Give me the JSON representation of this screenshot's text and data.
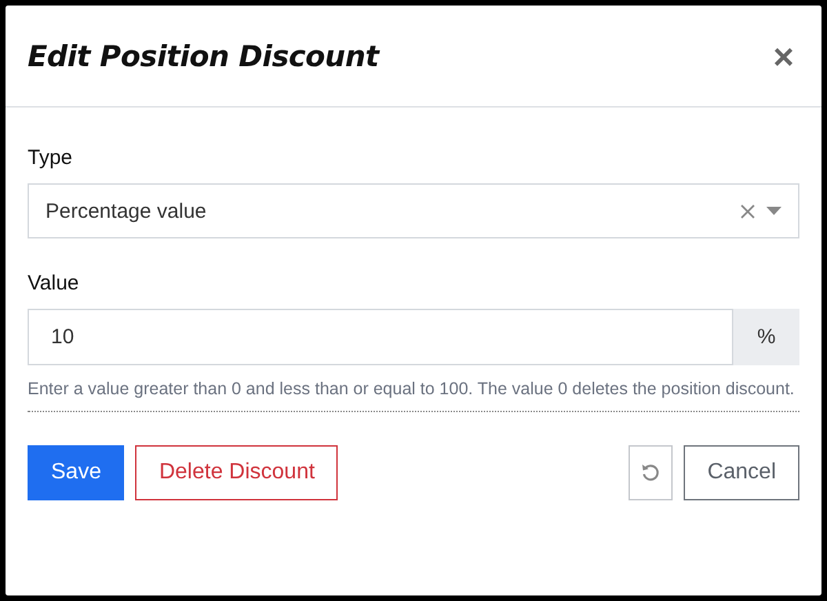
{
  "dialog": {
    "title": "Edit Position Discount",
    "close": "×"
  },
  "fields": [
    {
      "kind": "select",
      "label": "Type",
      "value": "Percentage value",
      "clearable": true
    },
    {
      "kind": "number",
      "label": "Value",
      "value": "10",
      "unit": "%",
      "help": "Enter a value greater than 0 and less than or equal to 100. The value 0 deletes the position discount."
    }
  ],
  "buttons": [
    {
      "kind": "primary",
      "label": "Save"
    },
    {
      "kind": "danger",
      "label": "Delete Discount"
    },
    {
      "kind": "reset",
      "disabled": true
    },
    {
      "kind": "secondary",
      "label": "Cancel"
    }
  ]
}
